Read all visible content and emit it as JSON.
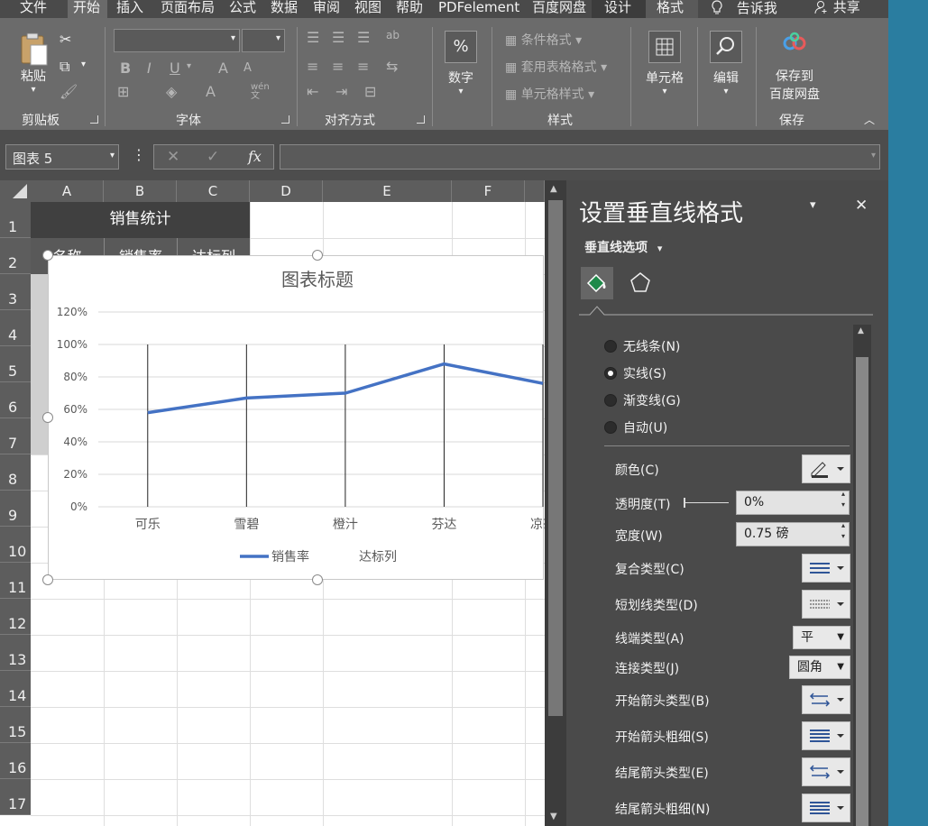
{
  "ribbon_tabs": [
    "文件",
    "开始",
    "插入",
    "页面布局",
    "公式",
    "数据",
    "审阅",
    "视图",
    "帮助",
    "PDFelement",
    "百度网盘",
    "设计",
    "格式",
    "告诉我",
    "共享"
  ],
  "ribbon": {
    "clipboard": {
      "paste": "粘贴",
      "group": "剪贴板"
    },
    "font": {
      "group": "字体",
      "bold": "B",
      "italic": "I",
      "underline": "U",
      "grow": "A",
      "shrink": "A",
      "font_color": "A",
      "phonetic": "wén\n文"
    },
    "align": {
      "group": "对齐方式"
    },
    "number": {
      "label": "数字",
      "symbol": "%"
    },
    "styles": {
      "group": "样式",
      "cond": "条件格式",
      "table": "套用表格格式",
      "cell": "单元格样式"
    },
    "cells": {
      "label": "单元格"
    },
    "edit": {
      "label": "编辑"
    },
    "save": {
      "label1": "保存到",
      "label2": "百度网盘",
      "group": "保存"
    }
  },
  "formula_bar": {
    "name_box": "图表 5",
    "fx": "fx",
    "cancel": "✕",
    "enter": "✓"
  },
  "sheet": {
    "columns": [
      "A",
      "B",
      "C",
      "D",
      "E",
      "F"
    ],
    "rows": [
      "1",
      "2",
      "3",
      "4",
      "5",
      "6",
      "7",
      "8",
      "9",
      "10",
      "11",
      "12",
      "13",
      "14",
      "15",
      "16",
      "17"
    ],
    "merged_title": "销售统计",
    "row2_cells": [
      "名称",
      "销售率",
      "达标列"
    ]
  },
  "chart_data": {
    "type": "line",
    "title": "图表标题",
    "categories": [
      "可乐",
      "雪碧",
      "橙汁",
      "芬达",
      "凉茶"
    ],
    "series": [
      {
        "name": "销售率",
        "values": [
          0.58,
          0.67,
          0.7,
          0.88,
          0.76
        ],
        "color": "#4472c4"
      },
      {
        "name": "达标列",
        "values": [],
        "color": "#ffffff"
      }
    ],
    "y_ticks": [
      "120%",
      "100%",
      "80%",
      "60%",
      "40%",
      "20%",
      "0%"
    ],
    "ylim": [
      0,
      1.2
    ],
    "drop_lines": true,
    "grid": true,
    "legend": "bottom"
  },
  "panel": {
    "title": "设置垂直线格式",
    "options_label": "垂直线选项",
    "radios": [
      {
        "label": "无线条(N)",
        "selected": false
      },
      {
        "label": "实线(S)",
        "selected": true
      },
      {
        "label": "渐变线(G)",
        "selected": false
      },
      {
        "label": "自动(U)",
        "selected": false
      }
    ],
    "props": {
      "color": "颜色(C)",
      "transparency": "透明度(T)",
      "transparency_value": "0%",
      "width": "宽度(W)",
      "width_value": "0.75 磅",
      "compound": "复合类型(C)",
      "dash": "短划线类型(D)",
      "cap": "线端类型(A)",
      "cap_value": "平",
      "join": "连接类型(J)",
      "join_value": "圆角",
      "begin_arrow": "开始箭头类型(B)",
      "begin_size": "开始箭头粗细(S)",
      "end_arrow": "结尾箭头类型(E)",
      "end_size": "结尾箭头粗细(N)"
    }
  }
}
